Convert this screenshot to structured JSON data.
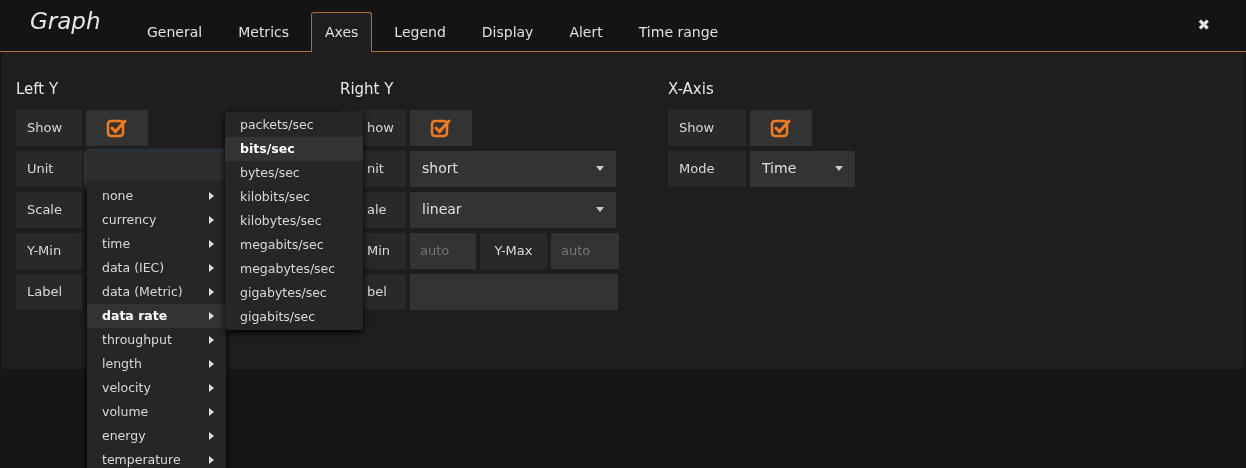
{
  "header": {
    "title": "Graph",
    "close": "✖"
  },
  "tabs": [
    {
      "label": "General",
      "selected": false
    },
    {
      "label": "Metrics",
      "selected": false
    },
    {
      "label": "Axes",
      "selected": true
    },
    {
      "label": "Legend",
      "selected": false
    },
    {
      "label": "Display",
      "selected": false
    },
    {
      "label": "Alert",
      "selected": false
    },
    {
      "label": "Time range",
      "selected": false
    }
  ],
  "sections": [
    {
      "title": "Left Y",
      "rows": [
        {
          "kind": "checkbox",
          "label": "Show",
          "checked": true
        },
        {
          "kind": "input",
          "label": "Unit"
        },
        {
          "kind": "label",
          "label": "Scale"
        },
        {
          "kind": "label",
          "label": "Y-Min"
        },
        {
          "kind": "label",
          "label": "Label"
        }
      ]
    },
    {
      "title": "Right Y",
      "rows": [
        {
          "kind": "checkbox",
          "label": "how",
          "checked": true
        },
        {
          "kind": "select",
          "label": "nit",
          "value": "short"
        },
        {
          "kind": "select",
          "label": "ale",
          "value": "linear"
        },
        {
          "kind": "minmax",
          "label": "Min",
          "min_placeholder": "auto",
          "max_label": "Y-Max",
          "max_placeholder": "auto"
        },
        {
          "kind": "input",
          "label": "bel"
        }
      ]
    },
    {
      "title": "X-Axis",
      "rows": [
        {
          "kind": "checkbox",
          "label": "Show",
          "checked": true
        },
        {
          "kind": "select",
          "label": "Mode",
          "value": "Time"
        }
      ]
    }
  ],
  "unit_menu": {
    "items": [
      {
        "label": "none",
        "selected": false
      },
      {
        "label": "currency",
        "selected": false
      },
      {
        "label": "time",
        "selected": false
      },
      {
        "label": "data (IEC)",
        "selected": false
      },
      {
        "label": "data (Metric)",
        "selected": false
      },
      {
        "label": "data rate",
        "selected": true
      },
      {
        "label": "throughput",
        "selected": false
      },
      {
        "label": "length",
        "selected": false
      },
      {
        "label": "velocity",
        "selected": false
      },
      {
        "label": "volume",
        "selected": false
      },
      {
        "label": "energy",
        "selected": false
      },
      {
        "label": "temperature",
        "selected": false
      }
    ],
    "submenu": [
      {
        "label": "packets/sec",
        "selected": false
      },
      {
        "label": "bits/sec",
        "selected": true
      },
      {
        "label": "bytes/sec",
        "selected": false
      },
      {
        "label": "kilobits/sec",
        "selected": false
      },
      {
        "label": "kilobytes/sec",
        "selected": false
      },
      {
        "label": "megabits/sec",
        "selected": false
      },
      {
        "label": "megabytes/sec",
        "selected": false
      },
      {
        "label": "gigabytes/sec",
        "selected": false
      },
      {
        "label": "gigabits/sec",
        "selected": false
      }
    ]
  }
}
